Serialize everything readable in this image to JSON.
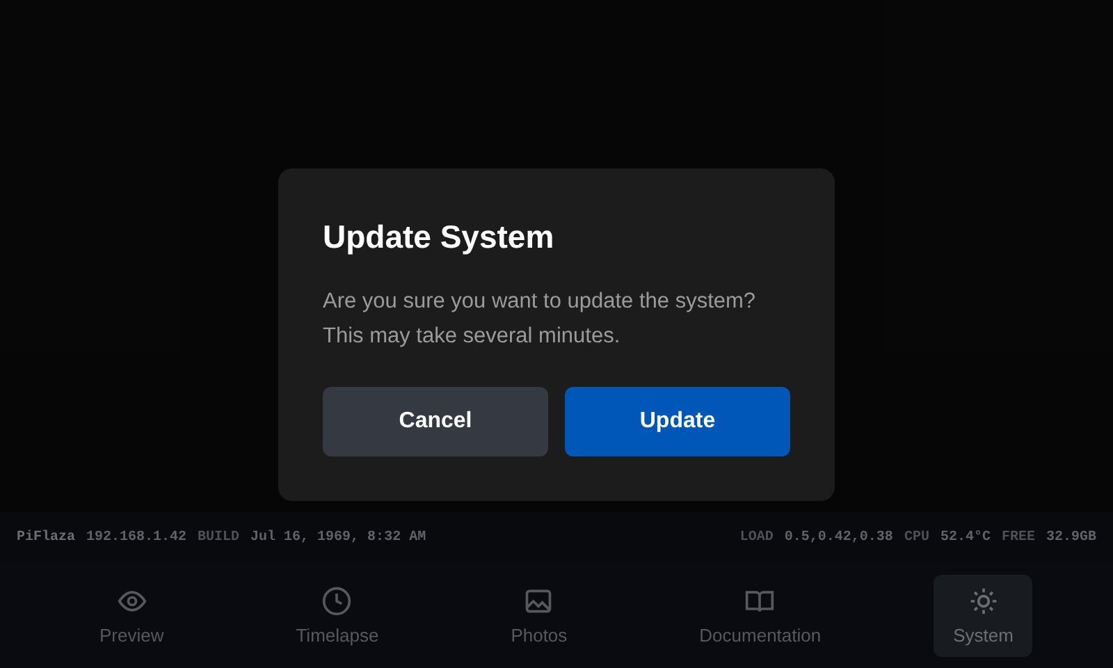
{
  "status_bar": {
    "left": [
      {
        "kind": "host",
        "text": "PiFlaza"
      },
      {
        "kind": "value",
        "text": "192.168.1.42"
      },
      {
        "kind": "label",
        "text": "BUILD"
      },
      {
        "kind": "value",
        "text": "Jul 16, 1969, 8:32 AM"
      }
    ],
    "right": [
      {
        "kind": "label",
        "text": "LOAD"
      },
      {
        "kind": "value",
        "text": "0.5,0.42,0.38"
      },
      {
        "kind": "label",
        "text": "CPU"
      },
      {
        "kind": "value",
        "text": "52.4°C"
      },
      {
        "kind": "label",
        "text": "FREE"
      },
      {
        "kind": "value",
        "text": "32.9GB"
      }
    ]
  },
  "nav": [
    {
      "label": "Preview",
      "selected": false
    },
    {
      "label": "Timelapse",
      "selected": false
    },
    {
      "label": "Photos",
      "selected": false
    },
    {
      "label": "Documentation",
      "selected": false
    },
    {
      "label": "System",
      "selected": true
    }
  ],
  "dialog": {
    "title": "Update System",
    "message": "Are you sure you want to update the system? This may take several minutes.",
    "buttons": [
      {
        "label": "Cancel",
        "kind": "secondary"
      },
      {
        "label": "Update",
        "kind": "primary"
      }
    ]
  }
}
